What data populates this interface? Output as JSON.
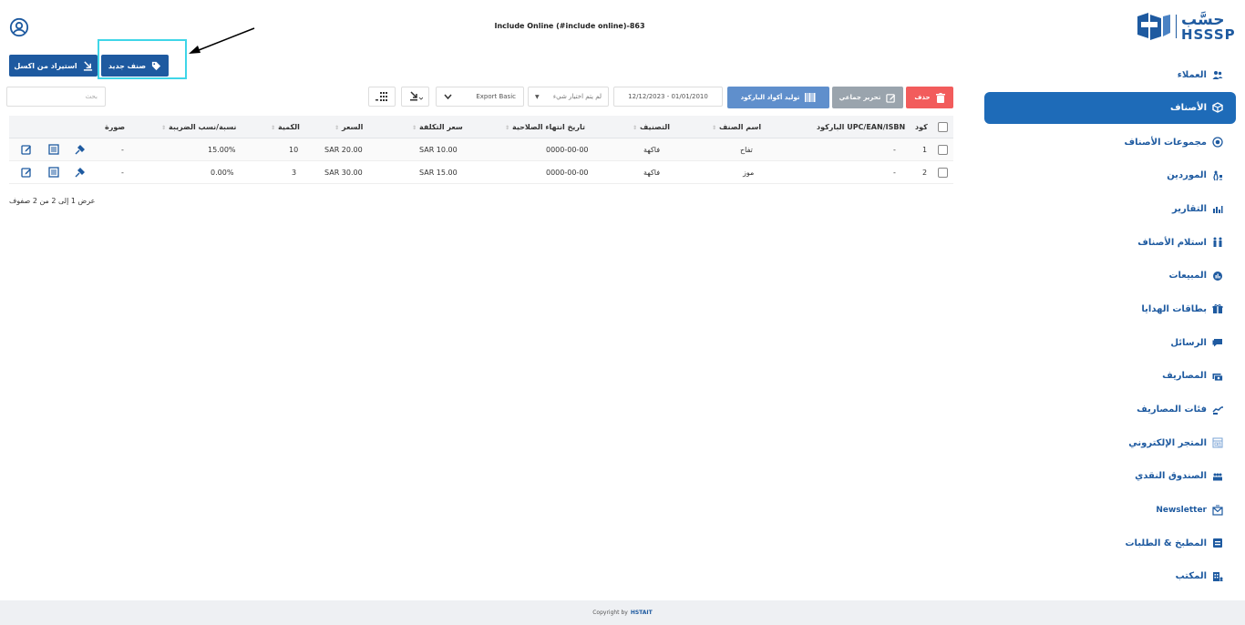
{
  "header": {
    "title": "Include Online (#include online)-863",
    "logo_ar": "حسَّب",
    "logo_en": "HSSSP"
  },
  "actions": {
    "import_excel": "استيراد من اكسل",
    "new_item": "صنف جديد"
  },
  "toolbar": {
    "search_placeholder": "بحث",
    "export_select": "Export Basic",
    "nothing_selected": "لم يتم اختيار شيء",
    "date_range": "12/12/2023 - 01/01/2010",
    "barcode_btn": "توليد أكواد الباركود",
    "bulk_edit_btn": "تحرير جماعي",
    "delete_btn": "حذف"
  },
  "table": {
    "columns": {
      "code": "كود",
      "barcode": "الباركود UPC/EAN/ISBN",
      "name": "اسم الصنف",
      "category": "التصنيف",
      "expiry": "تاريخ انتهاء الصلاحية",
      "cost": "سعر التكلفة",
      "price": "السعر",
      "qty": "الكمية",
      "tax": "نسبة/نسب الضريبة",
      "image": "صورة"
    },
    "rows": [
      {
        "code": "1",
        "barcode": "-",
        "name": "تفاح",
        "category": "فاكهة",
        "expiry": "0000-00-00",
        "cost": "SAR  10.00",
        "price": "SAR  20.00",
        "qty": "10",
        "tax": "15.00%",
        "image": "-"
      },
      {
        "code": "2",
        "barcode": "-",
        "name": "موز",
        "category": "فاكهة",
        "expiry": "0000-00-00",
        "cost": "SAR  15.00",
        "price": "SAR  30.00",
        "qty": "3",
        "tax": "0.00%",
        "image": "-"
      }
    ],
    "info": "عرض 1 إلى 2 من 2 صفوف"
  },
  "sidebar": {
    "items": [
      {
        "label": "العملاء",
        "icon": "users-icon"
      },
      {
        "label": "الأصناف",
        "icon": "box-icon",
        "active": true
      },
      {
        "label": "مجموعات الأصناف",
        "icon": "target-icon"
      },
      {
        "label": "الموردين",
        "icon": "supplier-icon"
      },
      {
        "label": "التقارير",
        "icon": "chart-icon"
      },
      {
        "label": "استلام الأصناف",
        "icon": "receive-icon"
      },
      {
        "label": "المبيعات",
        "icon": "sales-icon"
      },
      {
        "label": "بطاقات الهدايا",
        "icon": "gift-icon"
      },
      {
        "label": "الرسائل",
        "icon": "chat-icon"
      },
      {
        "label": "المصاريف",
        "icon": "money-icon"
      },
      {
        "label": "فئات المصاريف",
        "icon": "expense-category-icon"
      },
      {
        "label": "المتجر الإلكتروني",
        "icon": "store-icon"
      },
      {
        "label": "الصندوق النقدي",
        "icon": "cash-icon"
      },
      {
        "label": "Newsletter",
        "icon": "newsletter-icon"
      },
      {
        "label": "المطبخ & الطلبات",
        "icon": "kitchen-icon"
      },
      {
        "label": "المكتب",
        "icon": "office-icon"
      }
    ]
  },
  "footer": {
    "copyright": "Copyright by",
    "brand": "HSTAIT"
  },
  "colors": {
    "primary": "#1e5aa0",
    "active_nav": "#1e6bb8",
    "delete": "#f25c5c",
    "bulk": "#9aa4ad",
    "barcode": "#5f8fcc",
    "highlight": "#3fd6e8"
  }
}
